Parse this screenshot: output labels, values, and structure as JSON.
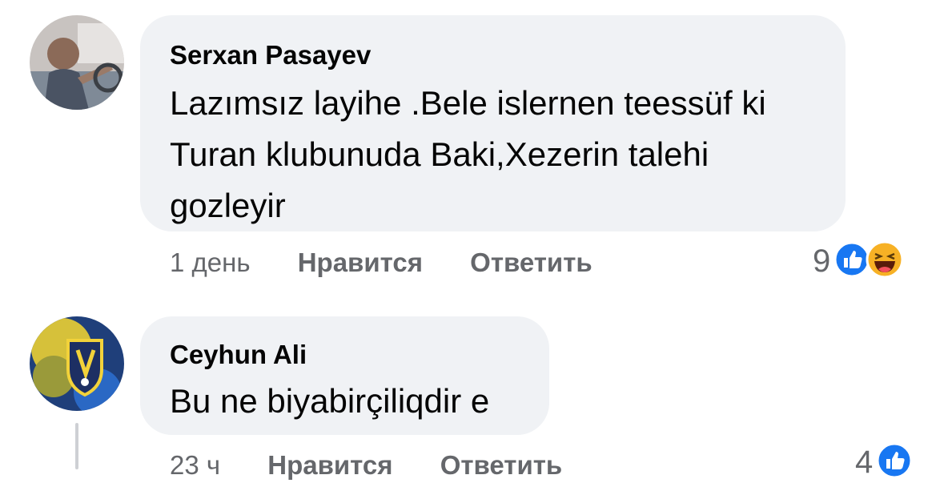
{
  "comments": [
    {
      "author": "Serxan Pasayev",
      "text_lines": [
        "Lazımsız layihe .Bele islernen teessüf ki",
        "Turan klubunuda Baki,Xezerin talehi",
        "gozleyir"
      ],
      "time": "1 день",
      "like_label": "Нравится",
      "reply_label": "Ответить",
      "reaction_count": "9",
      "reaction_icons": [
        "like-icon",
        "haha-icon"
      ],
      "colors": {
        "like": "#1877f2",
        "haha": "#f7b125"
      }
    },
    {
      "author": "Ceyhun Ali",
      "text_lines": [
        "Bu ne biyabirçiliqdir e"
      ],
      "time": "23 ч",
      "like_label": "Нравится",
      "reply_label": "Ответить",
      "reaction_count": "4",
      "reaction_icons": [
        "like-icon"
      ],
      "colors": {
        "like": "#1877f2"
      }
    }
  ]
}
